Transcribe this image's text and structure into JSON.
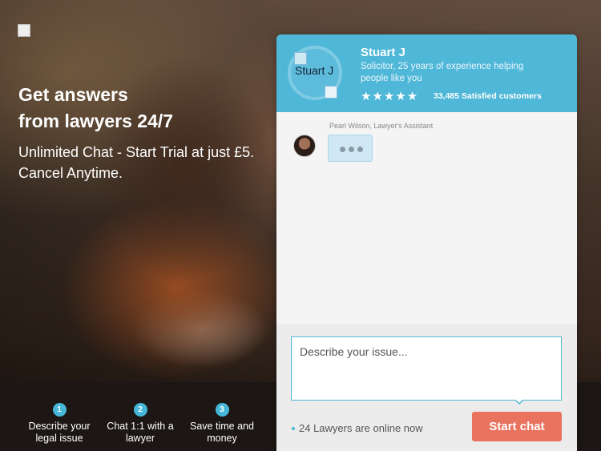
{
  "hero": {
    "headline_line1": "Get answers",
    "headline_line2": "from lawyers 24/7",
    "subtitle": "Unlimited Chat - Start Trial at just £5. Cancel Anytime."
  },
  "steps": [
    {
      "number": "1",
      "label": "Describe your legal issue"
    },
    {
      "number": "2",
      "label": "Chat 1:1 with a lawyer"
    },
    {
      "number": "3",
      "label": "Save time and money"
    }
  ],
  "expert": {
    "name": "Stuart J",
    "avatar_alt": "Stuart J",
    "description": "Solicitor, 25 years of experience helping people like you",
    "stars": "★★★★★",
    "rating": 5,
    "satisfied": "33,485 Satisfied customers"
  },
  "chat": {
    "author": "Pearl Wilson, Lawyer's Assistant"
  },
  "compose": {
    "placeholder": "Describe your issue...",
    "online_text": "24 Lawyers are online now",
    "start_label": "Start chat"
  },
  "colors": {
    "accent": "#4fb7d8",
    "button": "#e9735f"
  }
}
